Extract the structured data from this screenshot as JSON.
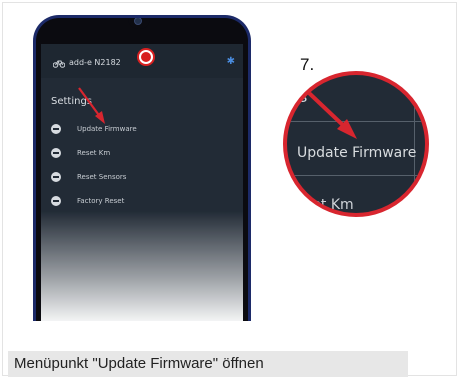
{
  "step_number": "7.",
  "app": {
    "device_name": "add-e N2182",
    "settings_title": "Settings",
    "menu_items": [
      {
        "label": "Update Firmware",
        "icon": "cloud-upload-icon"
      },
      {
        "label": "Reset Km",
        "icon": "reset-icon"
      },
      {
        "label": "Reset Sensors",
        "icon": "minus-circle-icon"
      },
      {
        "label": "Factory Reset",
        "icon": "minus-circle-icon"
      }
    ]
  },
  "zoom": {
    "settings_fragment": "s",
    "update_label": "Update Firmware",
    "reset_fragment": "set Km"
  },
  "caption": "Menüpunkt \"Update Firmware\" öffnen",
  "colors": {
    "accent_red": "#d8262f",
    "app_background": "#222b36",
    "bluetooth": "#4a8de0",
    "phone_frame": "#1c2a68"
  }
}
